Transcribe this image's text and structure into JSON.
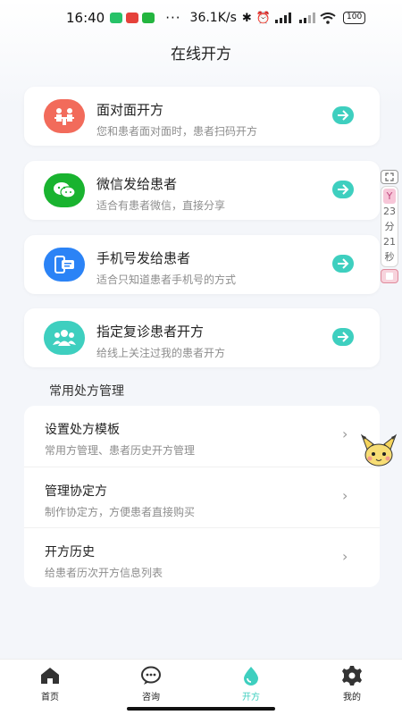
{
  "status_bar": {
    "time": "16:40",
    "dots": "···",
    "net_speed": "36.1K/s",
    "battery": "100"
  },
  "header": {
    "title": "在线开方"
  },
  "actions": [
    {
      "title": "面对面开方",
      "subtitle": "您和患者面对面时，患者扫码开方",
      "icon": "face-to-face-icon",
      "color": "#f26b5b"
    },
    {
      "title": "微信发给患者",
      "subtitle": "适合有患者微信，直接分享",
      "icon": "wechat-icon",
      "color": "#19b32f"
    },
    {
      "title": "手机号发给患者",
      "subtitle": "适合只知道患者手机号的方式",
      "icon": "phone-message-icon",
      "color": "#2b83f6"
    },
    {
      "title": "指定复诊患者开方",
      "subtitle": "给线上关注过我的患者开方",
      "icon": "patients-group-icon",
      "color": "#3ecfbf"
    }
  ],
  "section": {
    "title": "常用处方管理"
  },
  "list": [
    {
      "title": "设置处方模板",
      "subtitle": "常用方管理、患者历史开方管理"
    },
    {
      "title": "管理协定方",
      "subtitle": "制作协定方，方便患者直接购买"
    },
    {
      "title": "开方历史",
      "subtitle": "给患者历次开方信息列表"
    }
  ],
  "timer": {
    "top": "Y",
    "minutes": "23",
    "min_unit": "分",
    "seconds": "21",
    "sec_unit": "秒"
  },
  "nav": {
    "items": [
      {
        "label": "首页",
        "icon": "home-icon"
      },
      {
        "label": "咨询",
        "icon": "chat-icon"
      },
      {
        "label": "开方",
        "icon": "prescribe-icon"
      },
      {
        "label": "我的",
        "icon": "gear-icon"
      }
    ],
    "active_color": "#3ecfbf"
  }
}
